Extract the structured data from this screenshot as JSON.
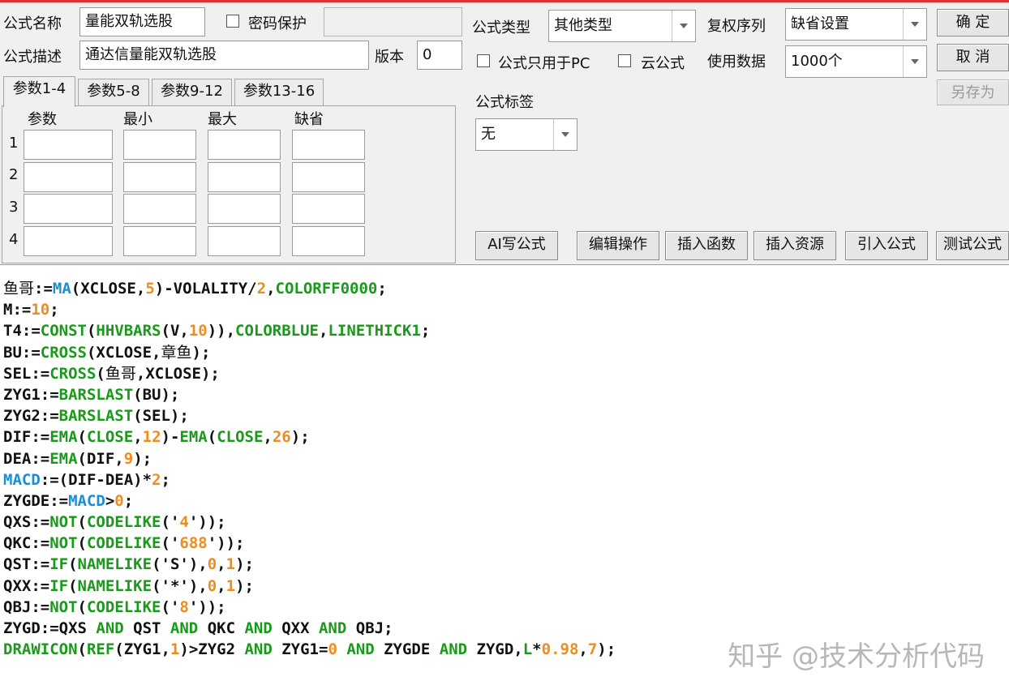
{
  "form": {
    "name_label": "公式名称",
    "name_value": "量能双轨选股",
    "password_label": "密码保护",
    "desc_label": "公式描述",
    "desc_value": "通达信量能双轨选股",
    "version_label": "版本",
    "version_value": "0",
    "type_label": "公式类型",
    "type_value": "其他类型",
    "fq_label": "复权序列",
    "fq_value": "缺省设置",
    "pc_only_label": "公式只用于PC",
    "cloud_label": "云公式",
    "data_label": "使用数据",
    "data_value": "1000个",
    "tag_label": "公式标签",
    "tag_value": "无"
  },
  "buttons": {
    "ok": "确 定",
    "cancel": "取 消",
    "save_as": "另存为",
    "ai": "AI写公式",
    "edit_ops": "编辑操作",
    "insert_func": "插入函数",
    "insert_res": "插入资源",
    "import_formula": "引入公式",
    "test_formula": "测试公式"
  },
  "tabs": [
    "参数1-4",
    "参数5-8",
    "参数9-12",
    "参数13-16"
  ],
  "params": {
    "headers": [
      "参数",
      "最小",
      "最大",
      "缺省"
    ],
    "rows": [
      "1",
      "2",
      "3",
      "4"
    ]
  },
  "code": [
    [
      [
        "鱼哥",
        "cn"
      ],
      [
        ":=",
        ""
      ],
      [
        "MA",
        "var"
      ],
      [
        "(XCLOSE,",
        ""
      ],
      [
        "5",
        "num"
      ],
      [
        ")-VOLALITY/",
        ""
      ],
      [
        "2",
        "num"
      ],
      [
        ",",
        ""
      ],
      [
        "COLORFF0000",
        "fn"
      ],
      [
        ";",
        ""
      ]
    ],
    [
      [
        "M:=",
        ""
      ],
      [
        "10",
        "num"
      ],
      [
        ";",
        ""
      ]
    ],
    [
      [
        "T4:=",
        ""
      ],
      [
        "CONST",
        "fn"
      ],
      [
        "(",
        ""
      ],
      [
        "HHVBARS",
        "fn"
      ],
      [
        "(V,",
        ""
      ],
      [
        "10",
        "num"
      ],
      [
        ")),",
        ""
      ],
      [
        "COLORBLUE",
        "fn"
      ],
      [
        ",",
        ""
      ],
      [
        "LINETHICK1",
        "fn"
      ],
      [
        ";",
        ""
      ]
    ],
    [
      [
        "BU:=",
        ""
      ],
      [
        "CROSS",
        "fn"
      ],
      [
        "(XCLOSE,",
        ""
      ],
      [
        "章鱼",
        "cn"
      ],
      [
        ");",
        ""
      ]
    ],
    [
      [
        "SEL:=",
        ""
      ],
      [
        "CROSS",
        "fn"
      ],
      [
        "(",
        ""
      ],
      [
        "鱼哥",
        "cn"
      ],
      [
        ",XCLOSE);",
        ""
      ]
    ],
    [
      [
        "ZYG1:=",
        ""
      ],
      [
        "BARSLAST",
        "fn"
      ],
      [
        "(BU);",
        ""
      ]
    ],
    [
      [
        "ZYG2:=",
        ""
      ],
      [
        "BARSLAST",
        "fn"
      ],
      [
        "(SEL);",
        ""
      ]
    ],
    [
      [
        "DIF:=",
        ""
      ],
      [
        "EMA",
        "fn"
      ],
      [
        "(",
        ""
      ],
      [
        "CLOSE",
        "fn"
      ],
      [
        ",",
        ""
      ],
      [
        "12",
        "num"
      ],
      [
        ")-",
        ""
      ],
      [
        "EMA",
        "fn"
      ],
      [
        "(",
        ""
      ],
      [
        "CLOSE",
        "fn"
      ],
      [
        ",",
        ""
      ],
      [
        "26",
        "num"
      ],
      [
        ");",
        ""
      ]
    ],
    [
      [
        "DEA:=",
        ""
      ],
      [
        "EMA",
        "fn"
      ],
      [
        "(DIF,",
        ""
      ],
      [
        "9",
        "num"
      ],
      [
        ");",
        ""
      ]
    ],
    [
      [
        "MACD",
        "var"
      ],
      [
        ":=(DIF-DEA)*",
        ""
      ],
      [
        "2",
        "num"
      ],
      [
        ";",
        ""
      ]
    ],
    [
      [
        "ZYGDE:=",
        ""
      ],
      [
        "MACD",
        "var"
      ],
      [
        ">",
        ""
      ],
      [
        "0",
        "num"
      ],
      [
        ";",
        ""
      ]
    ],
    [
      [
        "QXS:=",
        ""
      ],
      [
        "NOT",
        "fn"
      ],
      [
        "(",
        ""
      ],
      [
        "CODELIKE",
        "fn"
      ],
      [
        "('",
        ""
      ],
      [
        "4",
        "num"
      ],
      [
        "'));",
        ""
      ]
    ],
    [
      [
        "QKC:=",
        ""
      ],
      [
        "NOT",
        "fn"
      ],
      [
        "(",
        ""
      ],
      [
        "CODELIKE",
        "fn"
      ],
      [
        "('",
        ""
      ],
      [
        "688",
        "num"
      ],
      [
        "'));",
        ""
      ]
    ],
    [
      [
        "QST:=",
        ""
      ],
      [
        "IF",
        "fn"
      ],
      [
        "(",
        ""
      ],
      [
        "NAMELIKE",
        "fn"
      ],
      [
        "('S'),",
        ""
      ],
      [
        "0",
        "num"
      ],
      [
        ",",
        ""
      ],
      [
        "1",
        "num"
      ],
      [
        ");",
        ""
      ]
    ],
    [
      [
        "QXX:=",
        ""
      ],
      [
        "IF",
        "fn"
      ],
      [
        "(",
        ""
      ],
      [
        "NAMELIKE",
        "fn"
      ],
      [
        "('*'),",
        ""
      ],
      [
        "0",
        "num"
      ],
      [
        ",",
        ""
      ],
      [
        "1",
        "num"
      ],
      [
        ");",
        ""
      ]
    ],
    [
      [
        "QBJ:=",
        ""
      ],
      [
        "NOT",
        "fn"
      ],
      [
        "(",
        ""
      ],
      [
        "CODELIKE",
        "fn"
      ],
      [
        "('",
        ""
      ],
      [
        "8",
        "num"
      ],
      [
        "'));",
        ""
      ]
    ],
    [
      [
        "ZYGD:=QXS ",
        ""
      ],
      [
        "AND",
        "fn"
      ],
      [
        " QST ",
        ""
      ],
      [
        "AND",
        "fn"
      ],
      [
        " QKC ",
        ""
      ],
      [
        "AND",
        "fn"
      ],
      [
        " QXX ",
        ""
      ],
      [
        "AND",
        "fn"
      ],
      [
        " QBJ;",
        ""
      ]
    ],
    [
      [
        "DRAWICON",
        "fn"
      ],
      [
        "(",
        ""
      ],
      [
        "REF",
        "fn"
      ],
      [
        "(ZYG1,",
        ""
      ],
      [
        "1",
        "num"
      ],
      [
        ")>ZYG2 ",
        ""
      ],
      [
        "AND",
        "fn"
      ],
      [
        " ZYG1=",
        ""
      ],
      [
        "0",
        "num"
      ],
      [
        " ",
        ""
      ],
      [
        "AND",
        "fn"
      ],
      [
        " ZYGDE ",
        ""
      ],
      [
        "AND",
        "fn"
      ],
      [
        " ZYGD,",
        ""
      ],
      [
        "L",
        "fn"
      ],
      [
        "*",
        ""
      ],
      [
        "0.98",
        "num"
      ],
      [
        ",",
        ""
      ],
      [
        "7",
        "num"
      ],
      [
        ");",
        ""
      ]
    ]
  ],
  "watermark": "知乎 @技术分析代码"
}
